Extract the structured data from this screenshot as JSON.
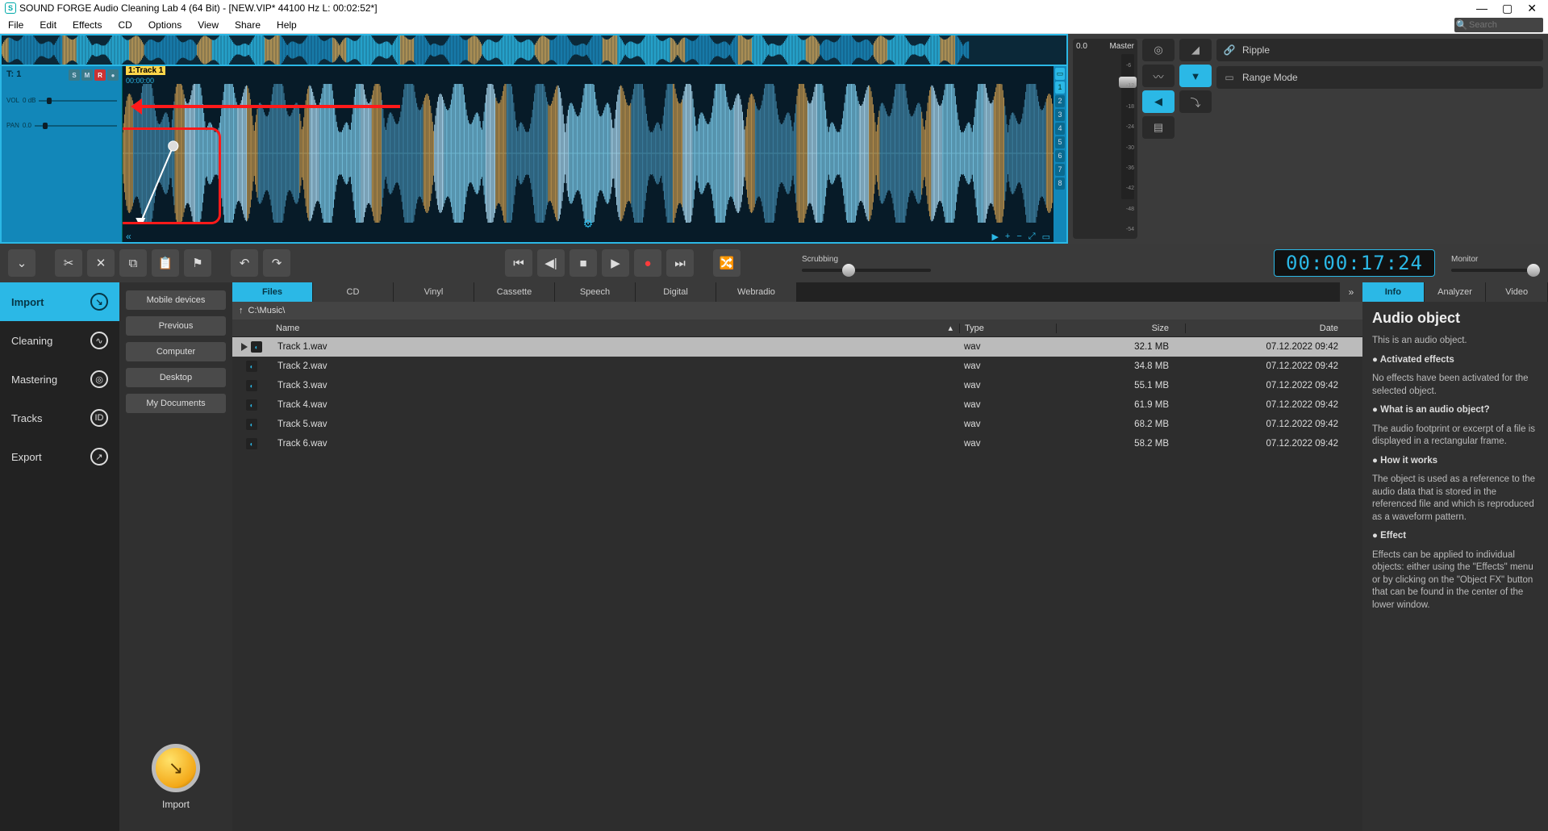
{
  "window": {
    "title": "SOUND FORGE Audio Cleaning Lab 4 (64 Bit) - [NEW.VIP*   44100 Hz L: 00:02:52*]"
  },
  "menu": [
    "File",
    "Edit",
    "Effects",
    "CD",
    "Options",
    "View",
    "Share",
    "Help"
  ],
  "search_placeholder": "Search",
  "meter": {
    "db": "0.0",
    "label": "Master",
    "scale": [
      "-6",
      "-12",
      "-18",
      "-24",
      "-30",
      "-36",
      "-42",
      "-48",
      "-54"
    ]
  },
  "right_toggles": {
    "ripple": "Ripple",
    "range": "Range Mode"
  },
  "track": {
    "id": "T:  1",
    "label": "1:Track 1",
    "timestamp": "00:00:00",
    "vol_label": "VOL",
    "vol_val": "0 dB",
    "pan_label": "PAN",
    "pan_val": "0.0",
    "markers": [
      "",
      "1",
      "2",
      "3",
      "4",
      "5",
      "6",
      "7",
      "8"
    ]
  },
  "toolbar": {
    "scrub_label": "Scrubbing",
    "timecode": "00:00:17:24",
    "monitor_label": "Monitor"
  },
  "leftnav": [
    {
      "label": "Import",
      "active": true
    },
    {
      "label": "Cleaning",
      "active": false
    },
    {
      "label": "Mastering",
      "active": false
    },
    {
      "label": "Tracks",
      "active": false
    },
    {
      "label": "Export",
      "active": false
    }
  ],
  "locations": [
    "Mobile devices",
    "Previous",
    "Computer",
    "Desktop",
    "My Documents"
  ],
  "import_big_label": "Import",
  "tabs": [
    "Files",
    "CD",
    "Vinyl",
    "Cassette",
    "Speech",
    "Digital",
    "Webradio"
  ],
  "active_tab": "Files",
  "path": "C:\\Music\\",
  "columns": {
    "name": "Name",
    "type": "Type",
    "size": "Size",
    "date": "Date"
  },
  "files": [
    {
      "name": "Track 1.wav",
      "type": "wav",
      "size": "32.1 MB",
      "date": "07.12.2022 09:42",
      "selected": true
    },
    {
      "name": "Track 2.wav",
      "type": "wav",
      "size": "34.8 MB",
      "date": "07.12.2022 09:42",
      "selected": false
    },
    {
      "name": "Track 3.wav",
      "type": "wav",
      "size": "55.1 MB",
      "date": "07.12.2022 09:42",
      "selected": false
    },
    {
      "name": "Track 4.wav",
      "type": "wav",
      "size": "61.9 MB",
      "date": "07.12.2022 09:42",
      "selected": false
    },
    {
      "name": "Track 5.wav",
      "type": "wav",
      "size": "68.2 MB",
      "date": "07.12.2022 09:42",
      "selected": false
    },
    {
      "name": "Track 6.wav",
      "type": "wav",
      "size": "58.2 MB",
      "date": "07.12.2022 09:42",
      "selected": false
    }
  ],
  "info_tabs": [
    "Info",
    "Analyzer",
    "Video"
  ],
  "info": {
    "title": "Audio object",
    "p1": "This is an audio object.",
    "b1": "● Activated effects",
    "p2": "No effects have been activated for the selected object.",
    "b2": "● What is an audio object?",
    "p3": "The audio footprint or excerpt of a file is displayed in a rectangular frame.",
    "b3": "● How it works",
    "p4": "The object is used as a reference to the audio data that is stored in the referenced file and which is reproduced as a waveform pattern.",
    "b4": "● Effect",
    "p5": "Effects can be applied to individual objects: either using the \"Effects\" menu or by clicking on the \"Object FX\" button that can be found in the center of the lower window."
  }
}
